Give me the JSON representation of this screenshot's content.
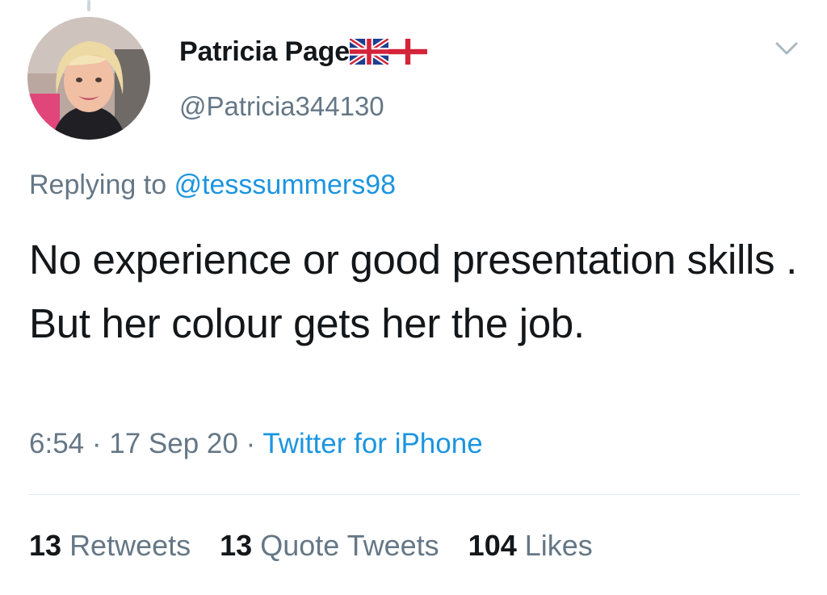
{
  "tweet": {
    "author": {
      "display_name": "Patricia Page",
      "flags": [
        "union-jack-flag-icon",
        "england-flag-icon"
      ],
      "handle": "@Patricia344130"
    },
    "menu_icon": "chevron-down-icon",
    "reply": {
      "prefix": "Replying to",
      "to_user": "@tesssummers98"
    },
    "text": "No experience or good presentation skills . But her colour gets her the job.",
    "meta": {
      "time": "6:54",
      "separator": "·",
      "date": "17 Sep 20",
      "source": "Twitter for iPhone"
    },
    "stats": {
      "retweets_count": "13",
      "retweets_label": "Retweets",
      "quote_tweets_count": "13",
      "quote_tweets_label": "Quote Tweets",
      "likes_count": "104",
      "likes_label": "Likes"
    }
  },
  "colors": {
    "text_primary": "#14171a",
    "text_secondary": "#657786",
    "link": "#1b95e0",
    "divider": "#e1e8ed"
  }
}
